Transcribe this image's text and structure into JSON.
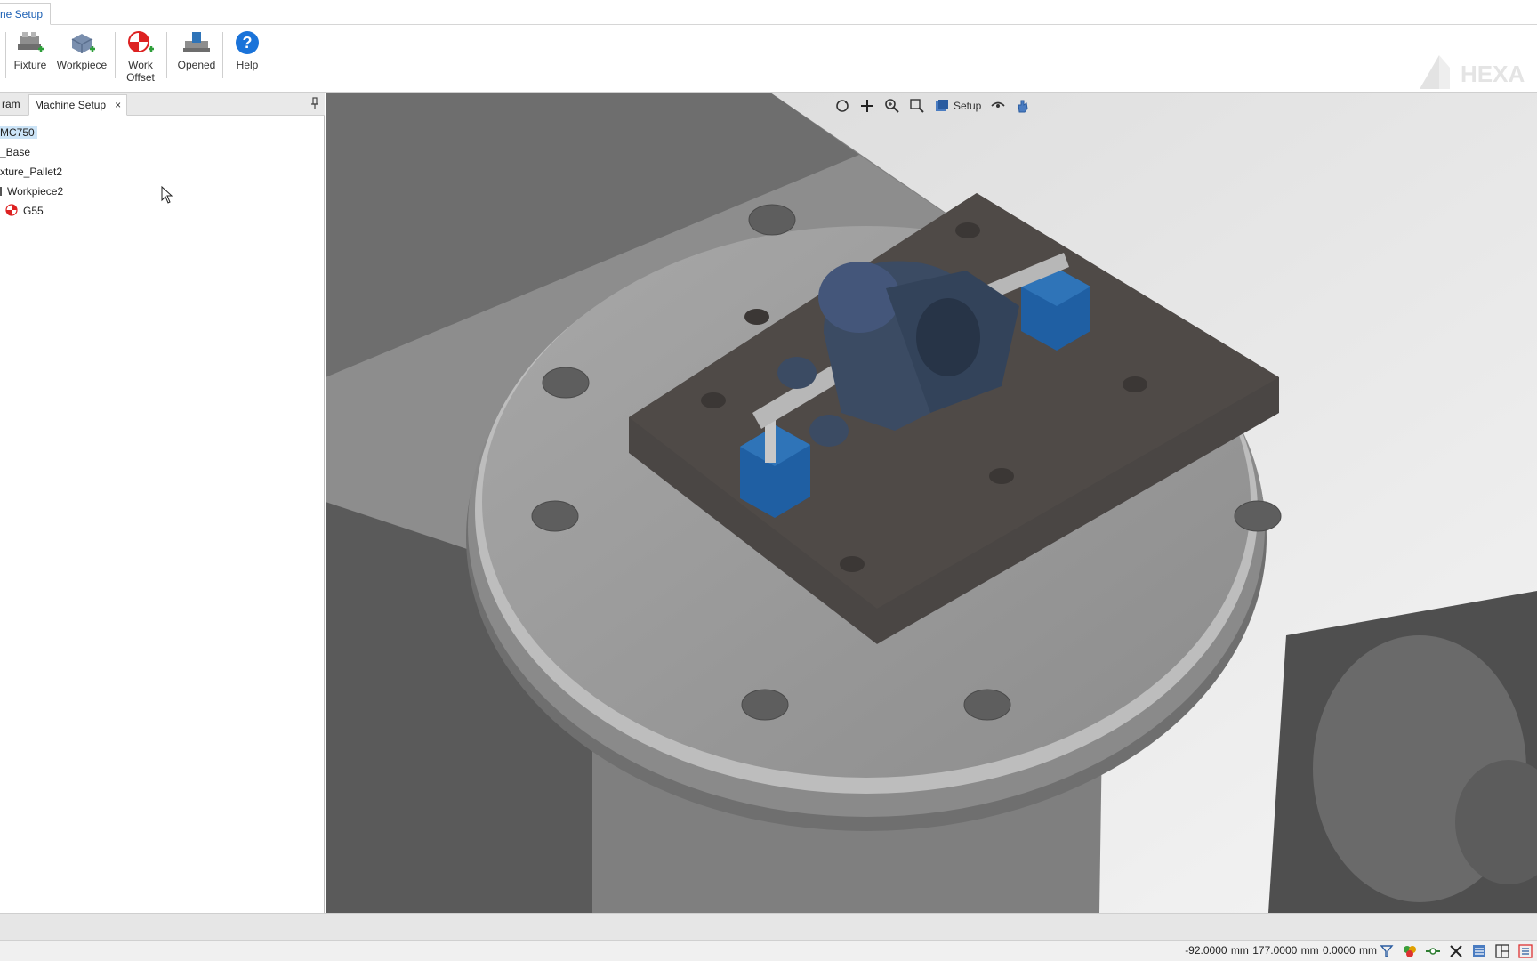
{
  "ribbon_tab": {
    "label": "ne Setup"
  },
  "ribbon": {
    "buttons": [
      {
        "label": "Fixture",
        "icon": "fixture-add-icon"
      },
      {
        "label": "Workpiece",
        "icon": "workpiece-add-icon"
      },
      {
        "label": "Work Offset",
        "label_line1": "Work",
        "label_line2": "Offset",
        "icon": "work-offset-add-icon"
      },
      {
        "label": "Opened",
        "icon": "opened-icon"
      },
      {
        "label": "Help",
        "icon": "help-icon"
      }
    ],
    "logo_text": "HEXA"
  },
  "left_panel": {
    "tabs": [
      {
        "label": "ram"
      },
      {
        "label": "Machine Setup",
        "close": "×"
      }
    ],
    "tree": [
      {
        "label": "MC750",
        "selected": true,
        "icon": null
      },
      {
        "label": "_Base",
        "icon": null
      },
      {
        "label": "xture_Pallet2",
        "icon": null
      },
      {
        "label": "Workpiece2",
        "icon": "workpiece-node-icon"
      },
      {
        "label": "G55",
        "icon": "work-offset-icon"
      }
    ]
  },
  "viewport": {
    "toolbar": [
      {
        "icon": "rotate-icon"
      },
      {
        "icon": "pan-icon"
      },
      {
        "icon": "zoom-icon"
      },
      {
        "icon": "zoom-window-icon"
      },
      {
        "icon": "view-setup-icon",
        "label": "Setup"
      },
      {
        "icon": "visibility-icon"
      },
      {
        "icon": "hand-icon"
      }
    ]
  },
  "status_bar": {
    "x": "-92.0000 mm",
    "y": "177.0000 mm",
    "z": "0.0000 mm",
    "icons": [
      "selection-filter-icon",
      "color-icon",
      "snap-icon",
      "cancel-icon",
      "list-icon",
      "layout-icon",
      "more-icon"
    ]
  },
  "colors": {
    "accent": "#1a5fb4",
    "selection": "#cce4f7",
    "part_blue": "#2f74b8",
    "workpiece_navy": "#3b4b63",
    "fixture_plate": "#4a4644",
    "table_gray": "#9a9a9a"
  }
}
